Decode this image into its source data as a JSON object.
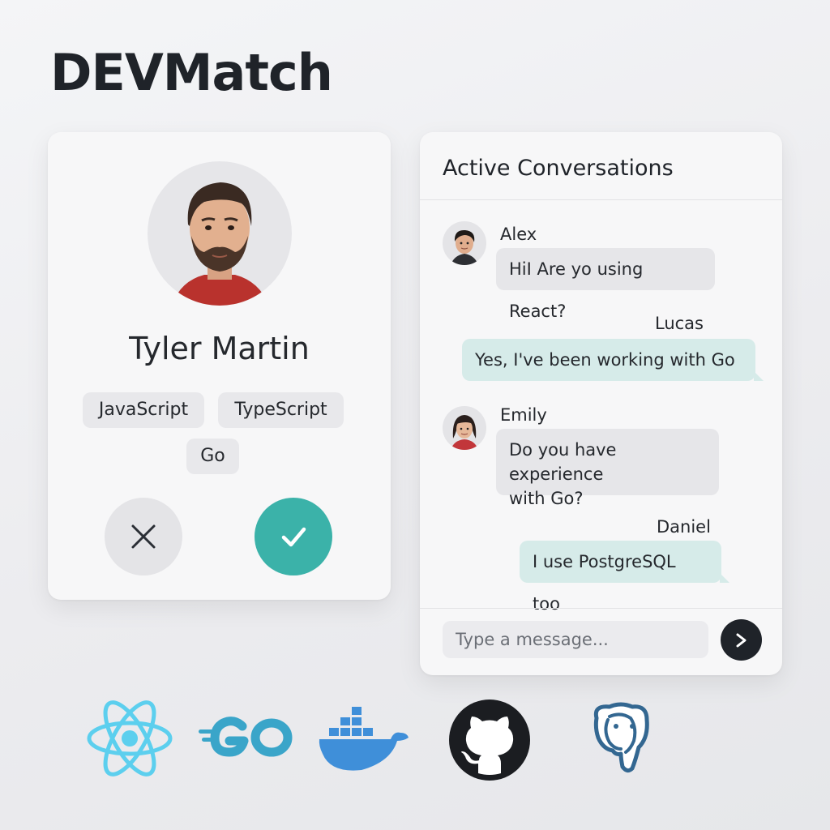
{
  "app": {
    "title": "DEVMatch"
  },
  "profile": {
    "name": "Tyler Martin",
    "tags": [
      "JavaScript",
      "TypeScript",
      "Go"
    ],
    "reject_icon": "close-icon",
    "accept_icon": "check-icon"
  },
  "chat": {
    "title": "Active Conversations",
    "messages": [
      {
        "sender": "Alex",
        "text": "HiI Are yo using React?",
        "direction": "incoming",
        "avatar": "avatar-alex"
      },
      {
        "sender": "Lucas",
        "text": "Yes, I've been working with Go",
        "direction": "outgoing"
      },
      {
        "sender": "Emily",
        "text": "Do you have experience with Go?",
        "text_lines": [
          "Do you have experience",
          "with Go?"
        ],
        "direction": "incoming",
        "avatar": "avatar-emily"
      },
      {
        "sender": "Daniel",
        "text": "I use PostgreSQL too",
        "direction": "outgoing"
      }
    ],
    "input_placeholder": "Type a message...",
    "send_icon": "arrow-right-icon"
  },
  "tech_logos": [
    "react-logo",
    "go-logo",
    "docker-logo",
    "github-logo",
    "postgresql-logo"
  ],
  "colors": {
    "accent": "#3bb2a9",
    "outgoing_bubble": "#d6ebe9",
    "incoming_bubble": "#e6e6e9",
    "dark": "#1f2329",
    "react": "#5ccfee",
    "go": "#3aa5c9",
    "docker": "#3f8fd9",
    "postgres": "#336791"
  }
}
